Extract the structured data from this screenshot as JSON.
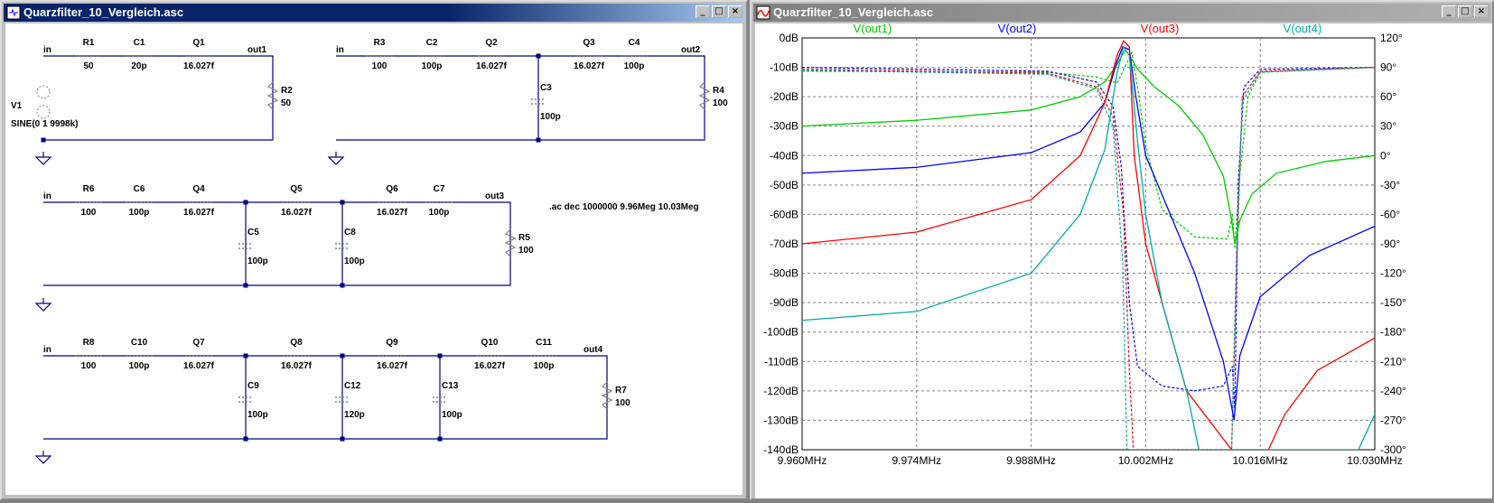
{
  "schematic_window": {
    "title": "Quarzfilter_10_Vergleich.asc",
    "directive": ".ac dec 1000000 9.96Meg 10.03Meg",
    "components": [
      {
        "id": "R1",
        "name": "R1",
        "value": "50"
      },
      {
        "id": "C1",
        "name": "C1",
        "value": "20p"
      },
      {
        "id": "Q1",
        "name": "Q1",
        "value": "16.027f"
      },
      {
        "id": "R2",
        "name": "R2",
        "value": "50"
      },
      {
        "id": "V1",
        "name": "V1",
        "value": "SINE(0 1 9998k)"
      },
      {
        "id": "R3",
        "name": "R3",
        "value": "100"
      },
      {
        "id": "C2",
        "name": "C2",
        "value": "100p"
      },
      {
        "id": "Q2",
        "name": "Q2",
        "value": "16.027f"
      },
      {
        "id": "Q3",
        "name": "Q3",
        "value": "16.027f"
      },
      {
        "id": "C4",
        "name": "C4",
        "value": "100p"
      },
      {
        "id": "R4",
        "name": "R4",
        "value": "100"
      },
      {
        "id": "C3",
        "name": "C3",
        "value": "100p"
      },
      {
        "id": "R6",
        "name": "R6",
        "value": "100"
      },
      {
        "id": "C6",
        "name": "C6",
        "value": "100p"
      },
      {
        "id": "Q4",
        "name": "Q4",
        "value": "16.027f"
      },
      {
        "id": "Q5",
        "name": "Q5",
        "value": "16.027f"
      },
      {
        "id": "Q6",
        "name": "Q6",
        "value": "16.027f"
      },
      {
        "id": "C7",
        "name": "C7",
        "value": "100p"
      },
      {
        "id": "R5",
        "name": "R5",
        "value": "100"
      },
      {
        "id": "C5",
        "name": "C5",
        "value": "100p"
      },
      {
        "id": "C8",
        "name": "C8",
        "value": "100p"
      },
      {
        "id": "R8",
        "name": "R8",
        "value": "100"
      },
      {
        "id": "C10",
        "name": "C10",
        "value": "100p"
      },
      {
        "id": "Q7",
        "name": "Q7",
        "value": "16.027f"
      },
      {
        "id": "Q8",
        "name": "Q8",
        "value": "16.027f"
      },
      {
        "id": "Q9",
        "name": "Q9",
        "value": "16.027f"
      },
      {
        "id": "Q10",
        "name": "Q10",
        "value": "16.027f"
      },
      {
        "id": "C11",
        "name": "C11",
        "value": "100p"
      },
      {
        "id": "R7",
        "name": "R7",
        "value": "100"
      },
      {
        "id": "C9",
        "name": "C9",
        "value": "100p"
      },
      {
        "id": "C12",
        "name": "C12",
        "value": "120p"
      },
      {
        "id": "C13",
        "name": "C13",
        "value": "100p"
      }
    ],
    "net_labels": {
      "in1": "in",
      "in2": "in",
      "in3": "in",
      "in4": "in",
      "out1": "out1",
      "out2": "out2",
      "out3": "out3",
      "out4": "out4"
    }
  },
  "plot_window": {
    "title": "Quarzfilter_10_Vergleich.asc",
    "colors": {
      "out1": "#00cc00",
      "out2": "#0000ff",
      "out3": "#ff0000",
      "out4": "#00aaaa",
      "grid": "#808080"
    },
    "chart_data": {
      "type": "line",
      "xlabel": "",
      "ylabel": "",
      "xlim": [
        9.96,
        10.03
      ],
      "ylim_left": [
        -140,
        0
      ],
      "ylim_right": [
        -300,
        120
      ],
      "grid": true,
      "legend_placement": "top",
      "x_ticks": [
        "9.960MHz",
        "9.974MHz",
        "9.988MHz",
        "10.002MHz",
        "10.016MHz",
        "10.030MHz"
      ],
      "y_ticks_left": [
        "0dB",
        "-10dB",
        "-20dB",
        "-30dB",
        "-40dB",
        "-50dB",
        "-60dB",
        "-70dB",
        "-80dB",
        "-90dB",
        "-100dB",
        "-110dB",
        "-120dB",
        "-130dB",
        "-140dB"
      ],
      "y_ticks_right": [
        "120°",
        "90°",
        "60°",
        "30°",
        "0°",
        "-30°",
        "-60°",
        "-90°",
        "-120°",
        "-150°",
        "-180°",
        "-210°",
        "-240°",
        "-270°",
        "-300°"
      ],
      "series": [
        {
          "name": "V(out1)",
          "key": "out1",
          "magnitude": [
            [
              9.96,
              -30
            ],
            [
              9.974,
              -28
            ],
            [
              9.988,
              -24.5
            ],
            [
              9.994,
              -20
            ],
            [
              9.997,
              -15
            ],
            [
              9.9985,
              -9
            ],
            [
              9.9995,
              -4
            ],
            [
              10.0,
              -6
            ],
            [
              10.001,
              -10.5
            ],
            [
              10.003,
              -16.5
            ],
            [
              10.006,
              -23
            ],
            [
              10.009,
              -33
            ],
            [
              10.0115,
              -47
            ],
            [
              10.0125,
              -62
            ],
            [
              10.0129,
              -70
            ],
            [
              10.0135,
              -62
            ],
            [
              10.015,
              -53
            ],
            [
              10.018,
              -46
            ],
            [
              10.024,
              -42
            ],
            [
              10.03,
              -40
            ]
          ],
          "phase": [
            [
              9.96,
              86
            ],
            [
              9.99,
              85
            ],
            [
              9.996,
              80
            ],
            [
              9.9985,
              74
            ],
            [
              10.0003,
              105
            ],
            [
              10.001,
              70
            ],
            [
              10.002,
              10
            ],
            [
              10.004,
              -55
            ],
            [
              10.008,
              -83
            ],
            [
              10.012,
              -85
            ],
            [
              10.0126,
              -60
            ],
            [
              10.0129,
              -95
            ],
            [
              10.0135,
              -20
            ],
            [
              10.0145,
              60
            ],
            [
              10.016,
              85
            ],
            [
              10.03,
              90
            ]
          ]
        },
        {
          "name": "V(out2)",
          "key": "out2",
          "magnitude": [
            [
              9.96,
              -46
            ],
            [
              9.974,
              -44
            ],
            [
              9.988,
              -39
            ],
            [
              9.994,
              -32
            ],
            [
              9.997,
              -22
            ],
            [
              9.9985,
              -8
            ],
            [
              9.9992,
              -3
            ],
            [
              10.0,
              -4
            ],
            [
              10.0008,
              -20
            ],
            [
              10.002,
              -40
            ],
            [
              10.005,
              -60
            ],
            [
              10.008,
              -80
            ],
            [
              10.0115,
              -110
            ],
            [
              10.0128,
              -130
            ],
            [
              10.0135,
              -108
            ],
            [
              10.016,
              -88
            ],
            [
              10.022,
              -74
            ],
            [
              10.03,
              -64
            ]
          ],
          "phase": [
            [
              9.96,
              90
            ],
            [
              9.99,
              86
            ],
            [
              9.996,
              75
            ],
            [
              9.998,
              50
            ],
            [
              9.999,
              -10
            ],
            [
              10.0,
              -150
            ],
            [
              10.001,
              -215
            ],
            [
              10.004,
              -235
            ],
            [
              10.008,
              -240
            ],
            [
              10.0115,
              -235
            ],
            [
              10.0126,
              -215
            ],
            [
              10.0129,
              -260
            ],
            [
              10.0133,
              -30
            ],
            [
              10.014,
              70
            ],
            [
              10.016,
              88
            ],
            [
              10.03,
              90
            ]
          ]
        },
        {
          "name": "V(out3)",
          "key": "out3",
          "magnitude": [
            [
              9.96,
              -70
            ],
            [
              9.974,
              -66
            ],
            [
              9.988,
              -55
            ],
            [
              9.994,
              -40
            ],
            [
              9.997,
              -22
            ],
            [
              9.9985,
              -6
            ],
            [
              9.9993,
              -1
            ],
            [
              10.0,
              -3
            ],
            [
              10.0006,
              -40
            ],
            [
              10.002,
              -70
            ],
            [
              10.004,
              -90
            ],
            [
              10.007,
              -120
            ],
            [
              10.0125,
              -140
            ],
            [
              10.017,
              -140
            ],
            [
              10.019,
              -128
            ],
            [
              10.023,
              -113
            ],
            [
              10.03,
              -102
            ]
          ],
          "phase": [
            [
              9.96,
              88
            ],
            [
              9.99,
              84
            ],
            [
              9.996,
              70
            ],
            [
              9.998,
              40
            ],
            [
              9.9993,
              -60
            ],
            [
              10.0,
              -220
            ],
            [
              10.0005,
              -300
            ],
            [
              10.0125,
              -300
            ],
            [
              10.0131,
              -120
            ],
            [
              10.0138,
              60
            ],
            [
              10.016,
              86
            ],
            [
              10.03,
              90
            ]
          ]
        },
        {
          "name": "V(out4)",
          "key": "out4",
          "magnitude": [
            [
              9.96,
              -96
            ],
            [
              9.974,
              -93
            ],
            [
              9.988,
              -80
            ],
            [
              9.994,
              -60
            ],
            [
              9.997,
              -38
            ],
            [
              9.9985,
              -12
            ],
            [
              9.9993,
              -3
            ],
            [
              10.0,
              -6
            ],
            [
              10.001,
              -35
            ],
            [
              10.002,
              -60
            ],
            [
              10.004,
              -90
            ],
            [
              10.007,
              -120
            ],
            [
              10.0085,
              -140
            ],
            [
              10.028,
              -140
            ],
            [
              10.03,
              -128
            ]
          ],
          "phase": [
            [
              9.96,
              87
            ],
            [
              9.99,
              83
            ],
            [
              9.996,
              68
            ],
            [
              9.998,
              30
            ],
            [
              9.9992,
              -110
            ],
            [
              9.9997,
              -300
            ],
            [
              10.0125,
              -300
            ],
            [
              10.0131,
              -100
            ],
            [
              10.0138,
              55
            ],
            [
              10.016,
              85
            ],
            [
              10.03,
              90
            ]
          ]
        }
      ]
    }
  }
}
